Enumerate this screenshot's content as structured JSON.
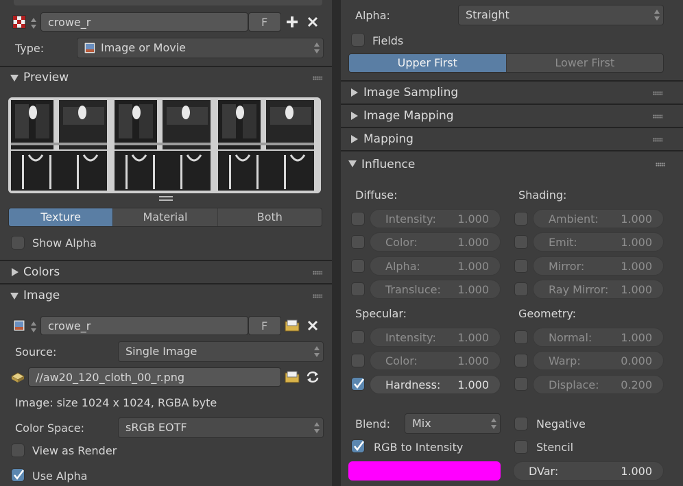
{
  "left": {
    "texture_name": "crowe_r",
    "fake_user": "F",
    "type_label": "Type:",
    "type_value": "Image or Movie",
    "preview_title": "Preview",
    "preview_tabs": [
      "Texture",
      "Material",
      "Both"
    ],
    "preview_tab_active": "Texture",
    "show_alpha": "Show Alpha",
    "colors_title": "Colors",
    "image_title": "Image",
    "image_name": "crowe_r",
    "image_fake_user": "F",
    "source_label": "Source:",
    "source_value": "Single Image",
    "filepath": "//aw20_120_cloth_00_r.png",
    "image_info": "Image: size 1024 x 1024, RGBA byte",
    "color_space_label": "Color Space:",
    "color_space_value": "sRGB EOTF",
    "view_as_render": "View as Render",
    "use_alpha": "Use Alpha"
  },
  "right": {
    "alpha_label": "Alpha:",
    "alpha_value": "Straight",
    "fields_label": "Fields",
    "field_order": [
      "Upper First",
      "Lower First"
    ],
    "field_order_active": "Upper First",
    "panels": [
      "Image Sampling",
      "Image Mapping",
      "Mapping"
    ],
    "influence_title": "Influence",
    "diffuse_title": "Diffuse:",
    "shading_title": "Shading:",
    "specular_title": "Specular:",
    "geometry_title": "Geometry:",
    "diffuse": [
      {
        "label": "Intensity:",
        "value": "1.000",
        "checked": false
      },
      {
        "label": "Color:",
        "value": "1.000",
        "checked": false
      },
      {
        "label": "Alpha:",
        "value": "1.000",
        "checked": false
      },
      {
        "label": "Transluce:",
        "value": "1.000",
        "checked": false
      }
    ],
    "shading": [
      {
        "label": "Ambient:",
        "value": "1.000",
        "checked": false
      },
      {
        "label": "Emit:",
        "value": "1.000",
        "checked": false
      },
      {
        "label": "Mirror:",
        "value": "1.000",
        "checked": false
      },
      {
        "label": "Ray Mirror:",
        "value": "1.000",
        "checked": false
      }
    ],
    "specular": [
      {
        "label": "Intensity:",
        "value": "1.000",
        "checked": false
      },
      {
        "label": "Color:",
        "value": "1.000",
        "checked": false
      },
      {
        "label": "Hardness:",
        "value": "1.000",
        "checked": true
      }
    ],
    "geometry": [
      {
        "label": "Normal:",
        "value": "1.000",
        "checked": false
      },
      {
        "label": "Warp:",
        "value": "0.000",
        "checked": false
      },
      {
        "label": "Displace:",
        "value": "0.200",
        "checked": false
      }
    ],
    "blend_label": "Blend:",
    "blend_value": "Mix",
    "negative_label": "Negative",
    "rgb_to_intensity": "RGB to Intensity",
    "stencil_label": "Stencil",
    "dvar_label": "DVar:",
    "dvar_value": "1.000",
    "color_swatch": "#ff00ff"
  },
  "colors": {
    "accent": "#5a7ea4",
    "background": "#3d3d3d",
    "swatch": "#ff00ff"
  }
}
